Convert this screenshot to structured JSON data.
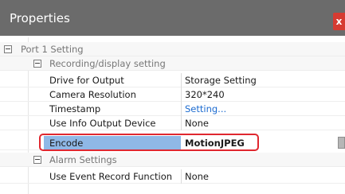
{
  "window": {
    "title": "Properties",
    "close_label": "x"
  },
  "tree": {
    "port_section": "Port 1 Setting",
    "recording_section": "Recording/display setting",
    "alarm_section": "Alarm Settings",
    "recording_props": [
      {
        "name": "Drive for Output",
        "value": "Storage Setting"
      },
      {
        "name": "Camera Resolution",
        "value": "320*240"
      },
      {
        "name": "Timestamp",
        "value": "Setting..."
      },
      {
        "name": "Use Info Output Device",
        "value": "None"
      },
      {
        "name": "Encode",
        "value": "MotionJPEG"
      }
    ],
    "alarm_props": [
      {
        "name": "Use Event Record Function",
        "value": "None"
      }
    ]
  },
  "colors": {
    "titlebar": "#6b6b6b",
    "close_button": "#d63b32",
    "selected_row": "#8fb8e6",
    "link": "#1c6bd0",
    "highlight_border": "#e0272f"
  }
}
